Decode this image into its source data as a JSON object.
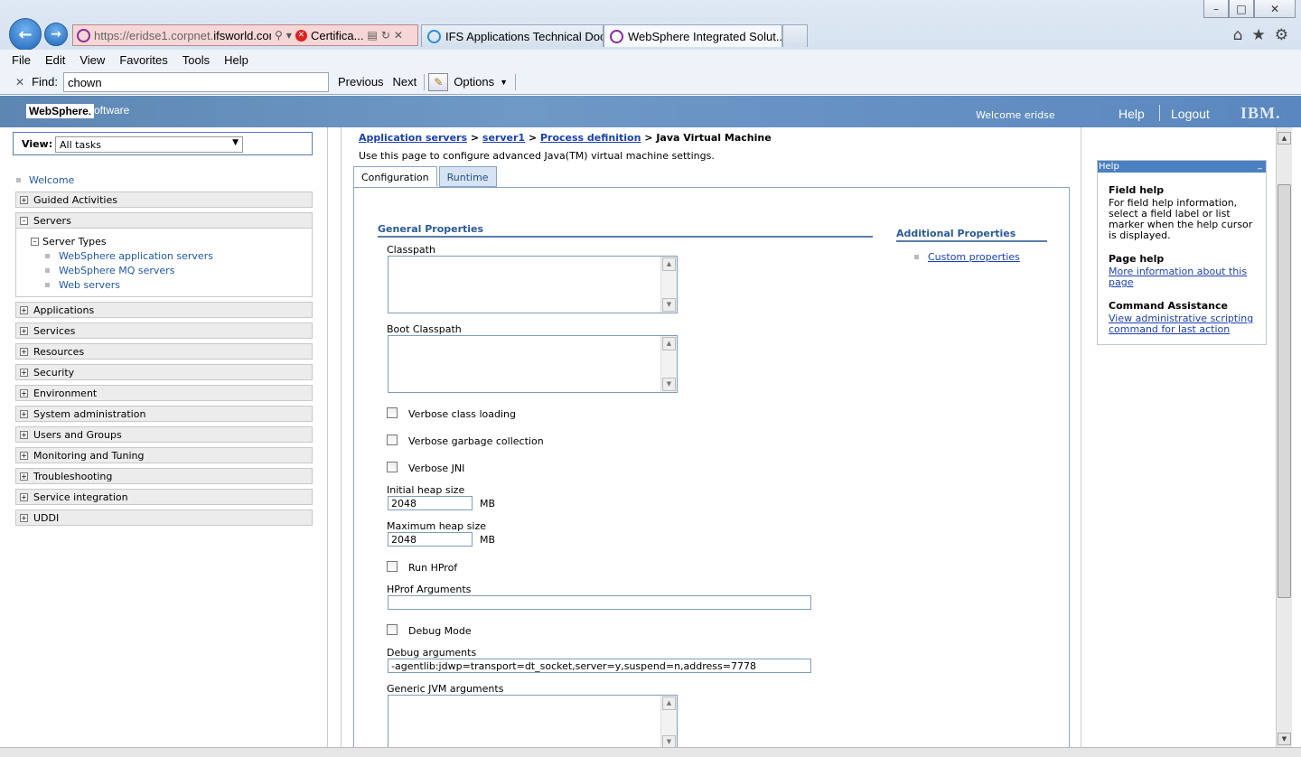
{
  "browser": {
    "url_prefix": "https://eridse1.corpnet.",
    "url_domain": "ifsworld.com",
    "url_suffix": "/",
    "cert_label": "Certifica...",
    "tabs": [
      {
        "label": "IFS Applications Technical Doc..."
      },
      {
        "label": "WebSphere Integrated Solut..."
      }
    ],
    "menu": [
      "File",
      "Edit",
      "View",
      "Favorites",
      "Tools",
      "Help"
    ],
    "find": {
      "label": "Find:",
      "value": "chown",
      "previous": "Previous",
      "next": "Next",
      "options": "Options"
    }
  },
  "header": {
    "logo": "WebSphere.",
    "software": "software",
    "welcome": "Welcome eridse",
    "help": "Help",
    "logout": "Logout",
    "ibm": "IBM."
  },
  "nav": {
    "view_label": "View:",
    "view_value": "All tasks",
    "welcome": "Welcome",
    "items": [
      {
        "label": "Guided Activities"
      },
      {
        "label": "Servers"
      },
      {
        "label": "Applications"
      },
      {
        "label": "Services"
      },
      {
        "label": "Resources"
      },
      {
        "label": "Security"
      },
      {
        "label": "Environment"
      },
      {
        "label": "System administration"
      },
      {
        "label": "Users and Groups"
      },
      {
        "label": "Monitoring and Tuning"
      },
      {
        "label": "Troubleshooting"
      },
      {
        "label": "Service integration"
      },
      {
        "label": "UDDI"
      }
    ],
    "server_types": "Server Types",
    "server_links": [
      "WebSphere application servers",
      "WebSphere MQ servers",
      "Web servers"
    ]
  },
  "main": {
    "breadcrumb": {
      "c1": "Application servers",
      "c2": "server1",
      "c3": "Process definition",
      "current": "Java Virtual Machine",
      "sep": " > "
    },
    "intro": "Use this page to configure advanced Java(TM) virtual machine settings.",
    "tabs": {
      "configuration": "Configuration",
      "runtime": "Runtime"
    },
    "general_properties": "General Properties",
    "additional_properties": "Additional Properties",
    "custom_properties": "Custom properties",
    "fields": {
      "classpath": "Classpath",
      "boot_classpath": "Boot Classpath",
      "verbose_class": "Verbose class loading",
      "verbose_gc": "Verbose garbage collection",
      "verbose_jni": "Verbose JNI",
      "initial_heap_label": "Initial heap size",
      "initial_heap_value": "2048",
      "max_heap_label": "Maximum heap size",
      "max_heap_value": "2048",
      "unit": "MB",
      "run_hprof": "Run HProf",
      "hprof_args": "HProf Arguments",
      "hprof_args_value": "",
      "debug_mode": "Debug Mode",
      "debug_args_label": "Debug arguments",
      "debug_args_value": "-agentlib:jdwp=transport=dt_socket,server=y,suspend=n,address=7778",
      "generic_jvm": "Generic JVM arguments"
    }
  },
  "help": {
    "title": "Help",
    "field_help_h": "Field help",
    "field_help_t": "For field help information, select a field label or list marker when the help cursor is displayed.",
    "page_help_h": "Page help",
    "page_help_link": "More information about this page",
    "cmd_h": "Command Assistance",
    "cmd_link": "View administrative scripting command for last action"
  }
}
